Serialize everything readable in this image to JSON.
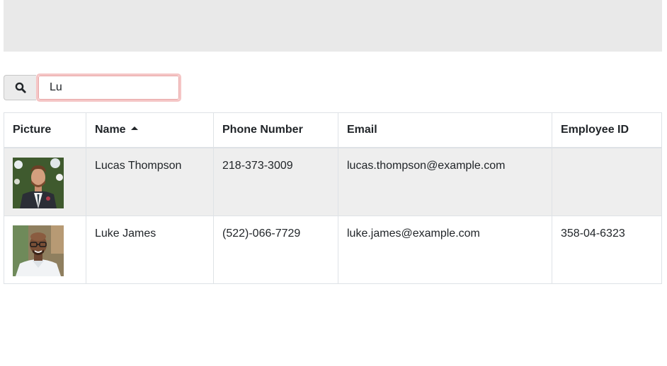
{
  "search": {
    "value": "Lu",
    "icon": "search-icon"
  },
  "table": {
    "columns": [
      {
        "label": "Picture"
      },
      {
        "label": "Name",
        "sort": "ascending"
      },
      {
        "label": "Phone Number"
      },
      {
        "label": "Email"
      },
      {
        "label": "Employee ID"
      }
    ],
    "rows": [
      {
        "picture": "avatar-man-beard-suit",
        "name": "Lucas Thompson",
        "phone": "218-373-3009",
        "email": "lucas.thompson@example.com",
        "employee_id": ""
      },
      {
        "picture": "avatar-man-glasses-white-shirt",
        "name": "Luke James",
        "phone": "(522)-066-7729",
        "email": "luke.james@example.com",
        "employee_id": "358-04-6323"
      }
    ]
  },
  "colors": {
    "header_band": "#e9e9e9",
    "row_stripe": "#eeeeee",
    "input_focus_ring": "#f5c6c6"
  }
}
